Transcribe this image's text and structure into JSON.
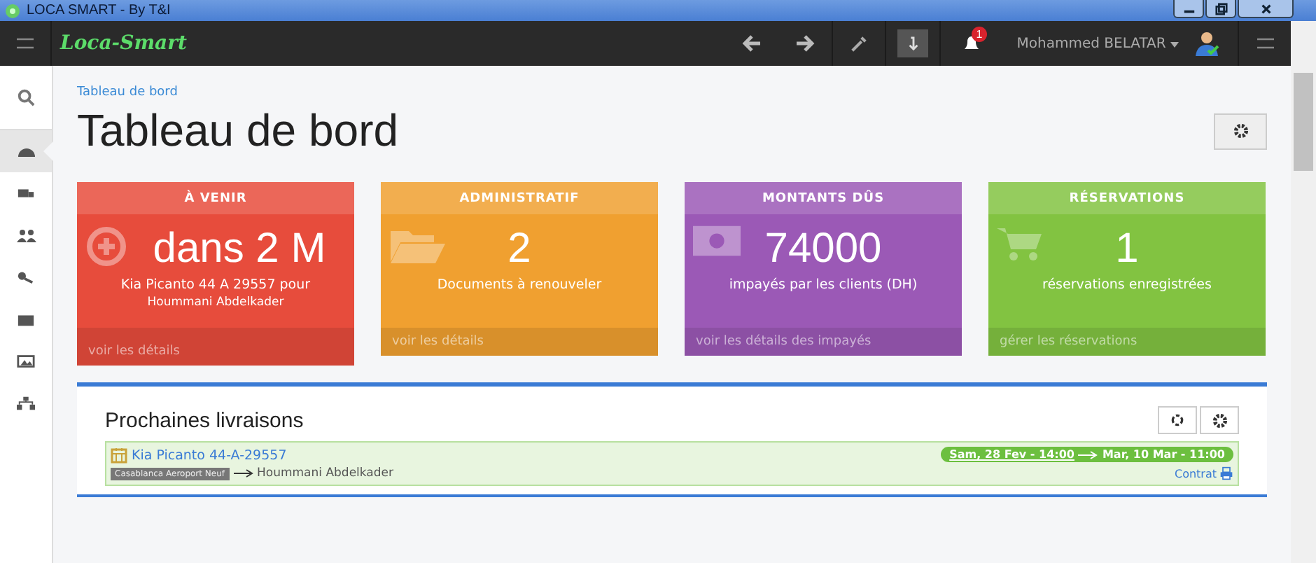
{
  "window": {
    "title": "LOCA SMART - By T&I"
  },
  "navbar": {
    "logo": "Loca-Smart",
    "notification_count": "1",
    "user": "Mohammed BELATAR"
  },
  "sidebar": {
    "items": [
      {
        "kind": "dashboard",
        "selected": true
      },
      {
        "kind": "truck",
        "selected": false
      },
      {
        "kind": "users",
        "selected": false
      },
      {
        "kind": "keys",
        "selected": false
      },
      {
        "kind": "briefcase",
        "selected": false
      },
      {
        "kind": "picture",
        "selected": false
      },
      {
        "kind": "sitemap",
        "selected": false
      }
    ]
  },
  "breadcrumb": "Tableau de bord",
  "page_title": "Tableau de bord",
  "cards": [
    {
      "kind": "plus",
      "color": "#e74c3c",
      "title": "À VENIR",
      "value": "dans 2 M",
      "lines": [
        "Kia Picanto 44 A 29557 pour",
        "Hoummani Abdelkader"
      ],
      "footer": "voir les détails"
    },
    {
      "kind": "folder",
      "color": "#f0a030",
      "title": "ADMINISTRATIF",
      "value": "2",
      "lines": [
        "Documents à renouveler"
      ],
      "footer": "voir les détails"
    },
    {
      "kind": "money",
      "color": "#9b59b6",
      "title": "MONTANTS DÛS",
      "value": "74000",
      "lines": [
        "impayés par les clients (DH)"
      ],
      "footer": "voir les détails des impayés"
    },
    {
      "kind": "cart",
      "color": "#82c341",
      "title": "RÉSERVATIONS",
      "value": "1",
      "lines": [
        "réservations enregistrées"
      ],
      "footer": "gérer les réservations"
    }
  ],
  "deliveries": {
    "title": "Prochaines livraisons",
    "items": [
      {
        "vehicle": "Kia Picanto 44-A-29557",
        "location": "Casablanca Aeroport Neuf",
        "client": "Hoummani Abdelkader",
        "start": "Sam, 28 Fev - 14:00",
        "end": "Mar, 10 Mar - 11:00",
        "contract": "Contrat"
      }
    ]
  }
}
